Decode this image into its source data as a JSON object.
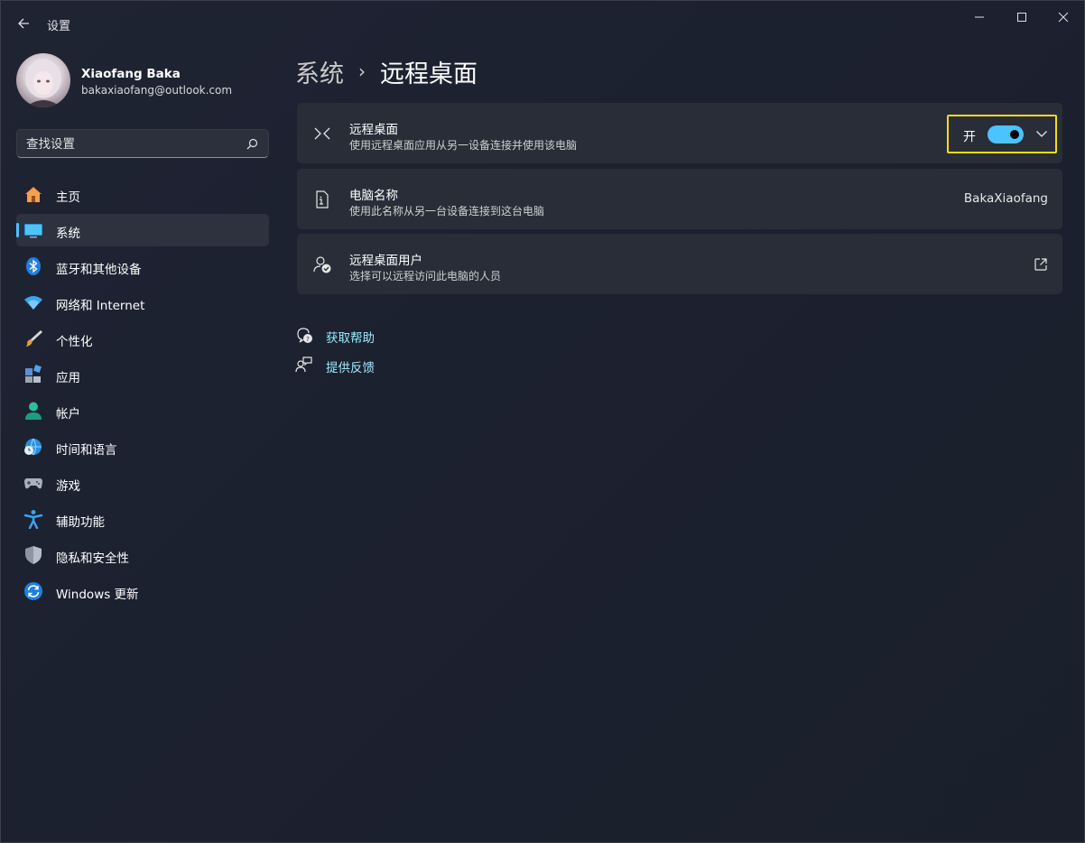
{
  "window": {
    "app_title": "设置"
  },
  "profile": {
    "name": "Xiaofang Baka",
    "email": "bakaxiaofang@outlook.com"
  },
  "search": {
    "placeholder": "查找设置"
  },
  "sidebar": {
    "items": [
      {
        "label": "主页",
        "icon": "home-icon",
        "active": false
      },
      {
        "label": "系统",
        "icon": "system-display-icon",
        "active": true
      },
      {
        "label": "蓝牙和其他设备",
        "icon": "bluetooth-icon",
        "active": false
      },
      {
        "label": "网络和 Internet",
        "icon": "wifi-icon",
        "active": false
      },
      {
        "label": "个性化",
        "icon": "brush-icon",
        "active": false
      },
      {
        "label": "应用",
        "icon": "apps-icon",
        "active": false
      },
      {
        "label": "帐户",
        "icon": "account-icon",
        "active": false
      },
      {
        "label": "时间和语言",
        "icon": "globe-clock-icon",
        "active": false
      },
      {
        "label": "游戏",
        "icon": "gamepad-icon",
        "active": false
      },
      {
        "label": "辅助功能",
        "icon": "accessibility-icon",
        "active": false
      },
      {
        "label": "隐私和安全性",
        "icon": "shield-icon",
        "active": false
      },
      {
        "label": "Windows 更新",
        "icon": "update-icon",
        "active": false
      }
    ]
  },
  "breadcrumb": {
    "parent": "系统",
    "current": "远程桌面"
  },
  "cards": {
    "remote_desktop": {
      "title": "远程桌面",
      "desc": "使用远程桌面应用从另一设备连接并使用该电脑",
      "toggle_label": "开",
      "toggle_on": true
    },
    "pc_name": {
      "title": "电脑名称",
      "desc": "使用此名称从另一台设备连接到这台电脑",
      "value": "BakaXiaofang"
    },
    "remote_users": {
      "title": "远程桌面用户",
      "desc": "选择可以远程访问此电脑的人员"
    }
  },
  "links": {
    "help": "获取帮助",
    "feedback": "提供反馈"
  },
  "colors": {
    "accent": "#4cc2ff",
    "link": "#99ebff",
    "highlight_border": "#f2dc16"
  }
}
